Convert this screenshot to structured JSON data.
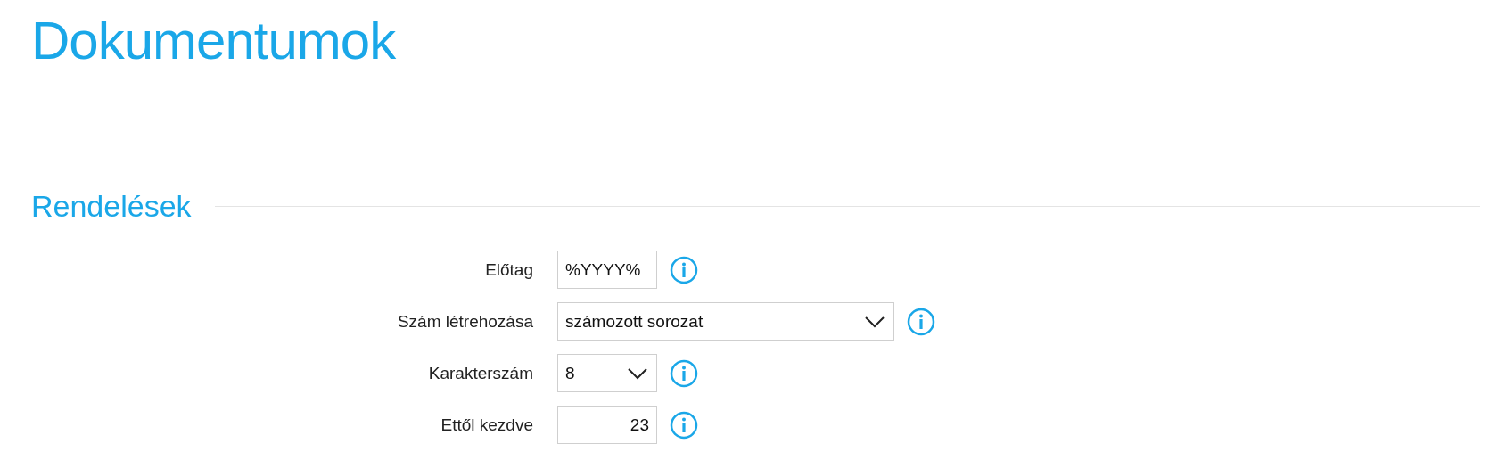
{
  "title": "Dokumentumok",
  "section": {
    "title": "Rendelések",
    "fields": [
      {
        "label": "Előtag",
        "kind": "text",
        "value": "%YYYY%"
      },
      {
        "label": "Szám létrehozása",
        "kind": "wide-select",
        "value": "számozott sorozat"
      },
      {
        "label": "Karakterszám",
        "kind": "select",
        "value": "8"
      },
      {
        "label": "Ettől kezdve",
        "kind": "number",
        "value": "23"
      }
    ]
  }
}
